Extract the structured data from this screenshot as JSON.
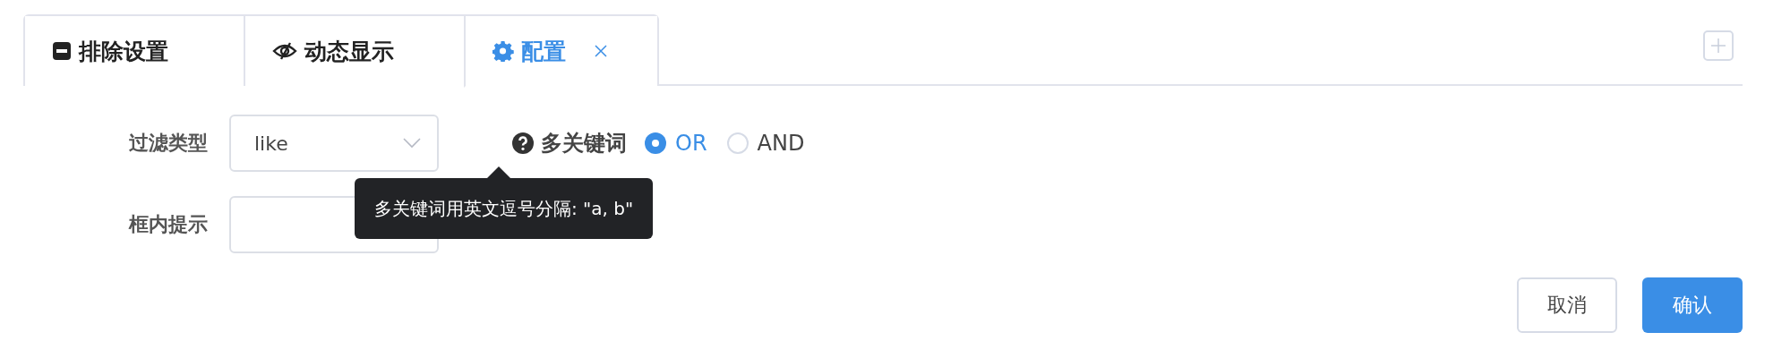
{
  "tabs": [
    {
      "label": "排除设置",
      "selected": false,
      "closable": false
    },
    {
      "label": "动态显示",
      "selected": false,
      "closable": false
    },
    {
      "label": "配置",
      "selected": true,
      "closable": true
    }
  ],
  "form": {
    "fields": [
      {
        "label": "过滤类型",
        "kind": "select",
        "value": "like"
      },
      {
        "label": "框内提示",
        "kind": "input"
      }
    ],
    "keywords": {
      "label": "多关键词",
      "options": [
        {
          "label": "OR",
          "selected": true
        },
        {
          "label": "AND",
          "selected": false
        }
      ]
    },
    "tooltip": {
      "text": "多关键词用英文逗号分隔: \"a, b\""
    }
  },
  "buttons": [
    {
      "label": "取消",
      "kind": "secondary"
    },
    {
      "label": "确认",
      "kind": "primary"
    }
  ]
}
